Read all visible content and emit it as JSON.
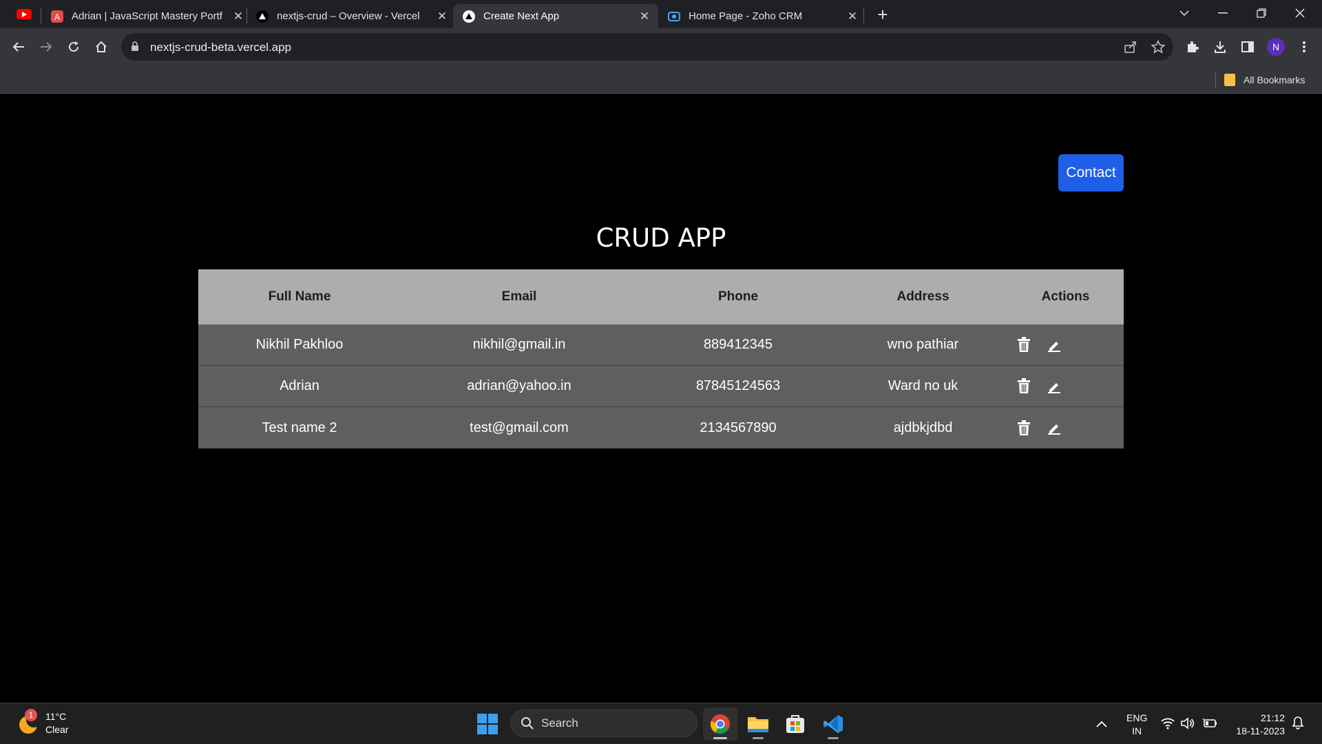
{
  "browser": {
    "tabs": [
      {
        "title": "Adrian | JavaScript Mastery Portf",
        "active": false
      },
      {
        "title": "nextjs-crud – Overview - Vercel",
        "active": false
      },
      {
        "title": "Create Next App",
        "active": true
      },
      {
        "title": "Home Page - Zoho CRM",
        "active": false
      }
    ],
    "url": "nextjs-crud-beta.vercel.app",
    "profile_initial": "N",
    "bookmarks_label": "All Bookmarks",
    "colors": {
      "tab_strip": "#1f2023",
      "toolbar": "#35363a",
      "avatar": "#5b2fb8"
    }
  },
  "page": {
    "contact_label": "Contact",
    "title": "CRUD APP",
    "table": {
      "headers": [
        "Full Name",
        "Email",
        "Phone",
        "Address",
        "Actions"
      ],
      "rows": [
        {
          "name": "Nikhil Pakhloo",
          "email": "nikhil@gmail.in",
          "phone": "889412345",
          "address": "wno pathiar"
        },
        {
          "name": "Adrian",
          "email": "adrian@yahoo.in",
          "phone": "87845124563",
          "address": "Ward no uk"
        },
        {
          "name": "Test name 2",
          "email": "test@gmail.com",
          "phone": "2134567890",
          "address": "ajdbkjdbd"
        }
      ]
    },
    "colors": {
      "contact_button": "#1f5ee6",
      "header_bg": "#adadad",
      "row_bg": "#5f5f5f"
    }
  },
  "taskbar": {
    "weather": {
      "temp": "11°C",
      "condition": "Clear",
      "badge": "1"
    },
    "search_label": "Search",
    "lang_line1": "ENG",
    "lang_line2": "IN",
    "time": "21:12",
    "date": "18-11-2023"
  }
}
